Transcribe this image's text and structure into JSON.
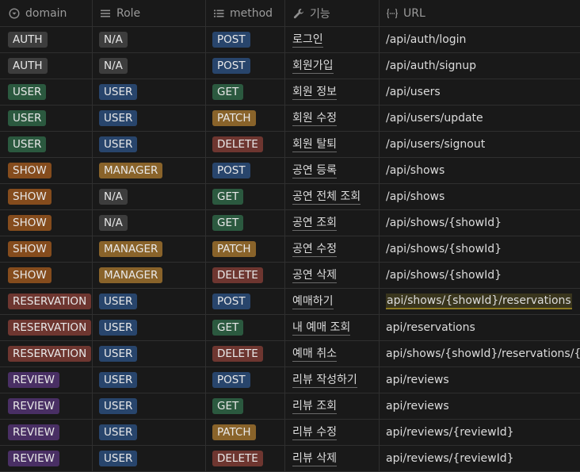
{
  "colors": {
    "background": "#191919",
    "tag_gray": "#3d3d3d",
    "tag_green": "#2b593f",
    "tag_blue": "#28456c",
    "tag_orange": "#854c1d",
    "tag_brown": "#89632a",
    "tag_red": "#6e3630",
    "tag_purple": "#492f64",
    "highlight": "#39351d"
  },
  "headers": {
    "domain": {
      "label": "domain",
      "icon": "dropdown-circle-icon"
    },
    "role": {
      "label": "Role",
      "icon": "list-lines-icon"
    },
    "method": {
      "label": "method",
      "icon": "bulleted-list-icon"
    },
    "feature": {
      "label": "기능",
      "icon": "wrench-icon"
    },
    "url": {
      "label": "URL",
      "icon": "code-braces-icon"
    }
  },
  "rows": [
    {
      "domain": "AUTH",
      "role": "N/A",
      "method": "POST",
      "feature": "로그인",
      "url": "/api/auth/login"
    },
    {
      "domain": "AUTH",
      "role": "N/A",
      "method": "POST",
      "feature": "회원가입",
      "url": "/api/auth/signup"
    },
    {
      "domain": "USER",
      "role": "USER",
      "method": "GET",
      "feature": "회원 정보",
      "url": "/api/users"
    },
    {
      "domain": "USER",
      "role": "USER",
      "method": "PATCH",
      "feature": "회원 수정",
      "url": "/api/users/update"
    },
    {
      "domain": "USER",
      "role": "USER",
      "method": "DELETE",
      "feature": "회원 탈퇴",
      "url": "/api/users/signout"
    },
    {
      "domain": "SHOW",
      "role": "MANAGER",
      "method": "POST",
      "feature": "공연 등록",
      "url": "/api/shows"
    },
    {
      "domain": "SHOW",
      "role": "N/A",
      "method": "GET",
      "feature": "공연 전체 조회",
      "url": "/api/shows"
    },
    {
      "domain": "SHOW",
      "role": "N/A",
      "method": "GET",
      "feature": "공연 조회",
      "url": "/api/shows/{showId}"
    },
    {
      "domain": "SHOW",
      "role": "MANAGER",
      "method": "PATCH",
      "feature": "공연 수정",
      "url": "/api/shows/{showId}"
    },
    {
      "domain": "SHOW",
      "role": "MANAGER",
      "method": "DELETE",
      "feature": "공연 삭제",
      "url": "/api/shows/{showId}"
    },
    {
      "domain": "RESERVATION",
      "role": "USER",
      "method": "POST",
      "feature": "예매하기",
      "url": "api/shows/{showId}/reservations"
    },
    {
      "domain": "RESERVATION",
      "role": "USER",
      "method": "GET",
      "feature": "내 예매 조회",
      "url": "api/reservations"
    },
    {
      "domain": "RESERVATION",
      "role": "USER",
      "method": "DELETE",
      "feature": "예매 취소",
      "url": "api/shows/{showId}/reservations/{reserv"
    },
    {
      "domain": "REVIEW",
      "role": "USER",
      "method": "POST",
      "feature": "리뷰 작성하기",
      "url": "api/reviews"
    },
    {
      "domain": "REVIEW",
      "role": "USER",
      "method": "GET",
      "feature": "리뷰 조회",
      "url": "api/reviews"
    },
    {
      "domain": "REVIEW",
      "role": "USER",
      "method": "PATCH",
      "feature": "리뷰 수정",
      "url": "api/reviews/{reviewId}"
    },
    {
      "domain": "REVIEW",
      "role": "USER",
      "method": "DELETE",
      "feature": "리뷰 삭제",
      "url": "api/reviews/{reviewId}"
    }
  ]
}
